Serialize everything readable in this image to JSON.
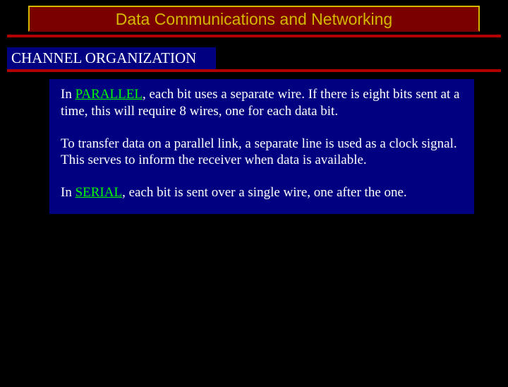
{
  "title": "Data Communications and Networking",
  "subheading": "CHANNEL ORGANIZATION",
  "body": {
    "p1_a": "In ",
    "p1_kw": "PARALLEL",
    "p1_b": ", each bit uses a separate wire. If there is eight bits sent at a time, this will require 8 wires, one for each data bit.",
    "p2": "To transfer data on a parallel link, a separate line is used as a clock signal. This serves to inform the receiver when data is available.",
    "p3_a": "In ",
    "p3_kw": "SERIAL",
    "p3_b": ", each bit is sent over a single wire, one after the one."
  }
}
